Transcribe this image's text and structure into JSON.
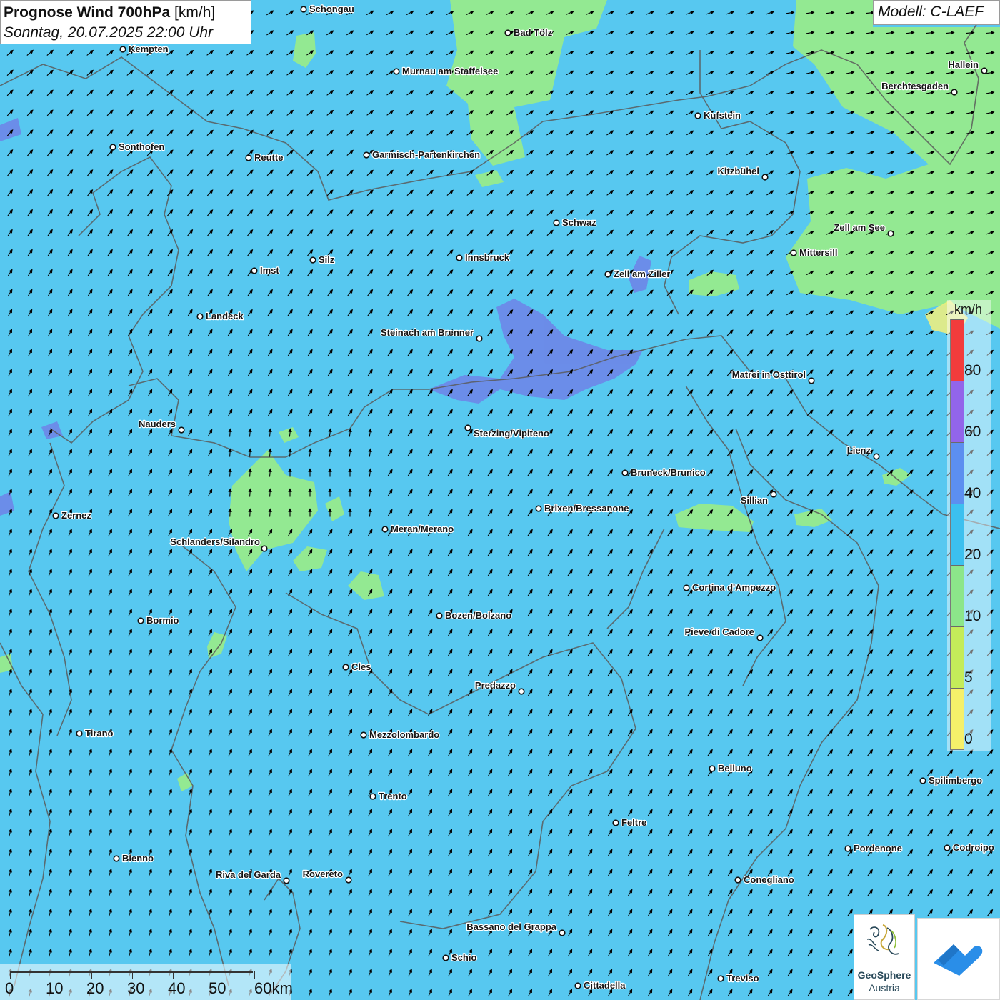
{
  "header": {
    "title": "Prognose Wind 700hPa",
    "unit": "[km/h]",
    "subtitle": "Sonntag, 20.07.2025 22:00 Uhr"
  },
  "model": {
    "label": "Modell: C-LAEF"
  },
  "legend": {
    "unit": "km/h",
    "ticks": [
      "0",
      "5",
      "10",
      "20",
      "40",
      "60",
      "80"
    ],
    "colors": [
      "#f5f06a",
      "#c4ec5a",
      "#8ce68a",
      "#3cc0ef",
      "#5c8ff0",
      "#9265ea",
      "#f23c3c"
    ]
  },
  "scale": {
    "labels": [
      "0",
      "10",
      "20",
      "30",
      "40",
      "50",
      "60km"
    ]
  },
  "cities": [
    {
      "name": "Schongau",
      "label": "Schongau"
    },
    {
      "name": "bad-toelz",
      "label": "Bad Tölz"
    },
    {
      "name": "kempten",
      "label": "Kempten"
    },
    {
      "name": "murnau",
      "label": "Murnau am Staffelsee"
    },
    {
      "name": "hallein",
      "label": "Hallein"
    },
    {
      "name": "berchtesgaden",
      "label": "Berchtesgaden"
    },
    {
      "name": "kufstein",
      "label": "Kufstein"
    },
    {
      "name": "sonthofen",
      "label": "Sonthofen"
    },
    {
      "name": "reutte",
      "label": "Reutte"
    },
    {
      "name": "garmisch",
      "label": "Garmisch-Partenkirchen"
    },
    {
      "name": "kitzbuehel",
      "label": "Kitzbühel"
    },
    {
      "name": "schwaz",
      "label": "Schwaz"
    },
    {
      "name": "zell-am-see",
      "label": "Zell am See"
    },
    {
      "name": "mittersill",
      "label": "Mittersill"
    },
    {
      "name": "innsbruck",
      "label": "Innsbruck"
    },
    {
      "name": "silz",
      "label": "Silz"
    },
    {
      "name": "imst",
      "label": "Imst"
    },
    {
      "name": "zell-am-ziller",
      "label": "Zell am Ziller"
    },
    {
      "name": "landeck",
      "label": "Landeck"
    },
    {
      "name": "steinach",
      "label": "Steinach am Brenner"
    },
    {
      "name": "matrei",
      "label": "Matrei in Osttirol"
    },
    {
      "name": "nauders",
      "label": "Nauders"
    },
    {
      "name": "sterzing",
      "label": "Sterzing/Vipiteno"
    },
    {
      "name": "lienz",
      "label": "Lienz"
    },
    {
      "name": "bruneck",
      "label": "Bruneck/Brunico"
    },
    {
      "name": "sillian",
      "label": "Sillian"
    },
    {
      "name": "zernez",
      "label": "Zernez"
    },
    {
      "name": "brixen",
      "label": "Brixen/Bressanone"
    },
    {
      "name": "meran",
      "label": "Meran/Merano"
    },
    {
      "name": "schlanders",
      "label": "Schlanders/Silandro"
    },
    {
      "name": "cortina",
      "label": "Cortina d'Ampezzo"
    },
    {
      "name": "bozen",
      "label": "Bozen/Bolzano"
    },
    {
      "name": "bormio",
      "label": "Bormio"
    },
    {
      "name": "pieve-di-cadore",
      "label": "Pieve di Cadore"
    },
    {
      "name": "cles",
      "label": "Cles"
    },
    {
      "name": "predazzo",
      "label": "Predazzo"
    },
    {
      "name": "tirano",
      "label": "Tirano"
    },
    {
      "name": "mezzolombardo",
      "label": "Mezzolombardo"
    },
    {
      "name": "belluno",
      "label": "Belluno"
    },
    {
      "name": "spilimbergo",
      "label": "Spilimbergo"
    },
    {
      "name": "trento",
      "label": "Trento"
    },
    {
      "name": "feltre",
      "label": "Feltre"
    },
    {
      "name": "bienno",
      "label": "Bienno"
    },
    {
      "name": "pordenone",
      "label": "Pordenone"
    },
    {
      "name": "codroipo",
      "label": "Codroipo"
    },
    {
      "name": "riva-del-garda",
      "label": "Riva del Garda"
    },
    {
      "name": "rovereto",
      "label": "Rovereto"
    },
    {
      "name": "conegliano",
      "label": "Conegliano"
    },
    {
      "name": "bassano",
      "label": "Bassano del Grappa"
    },
    {
      "name": "schio",
      "label": "Schio"
    },
    {
      "name": "treviso",
      "label": "Treviso"
    },
    {
      "name": "cittadella",
      "label": "Cittadella"
    }
  ],
  "logos": {
    "geosphere_name": "GeoSphere",
    "geosphere_sub": "Austria"
  }
}
